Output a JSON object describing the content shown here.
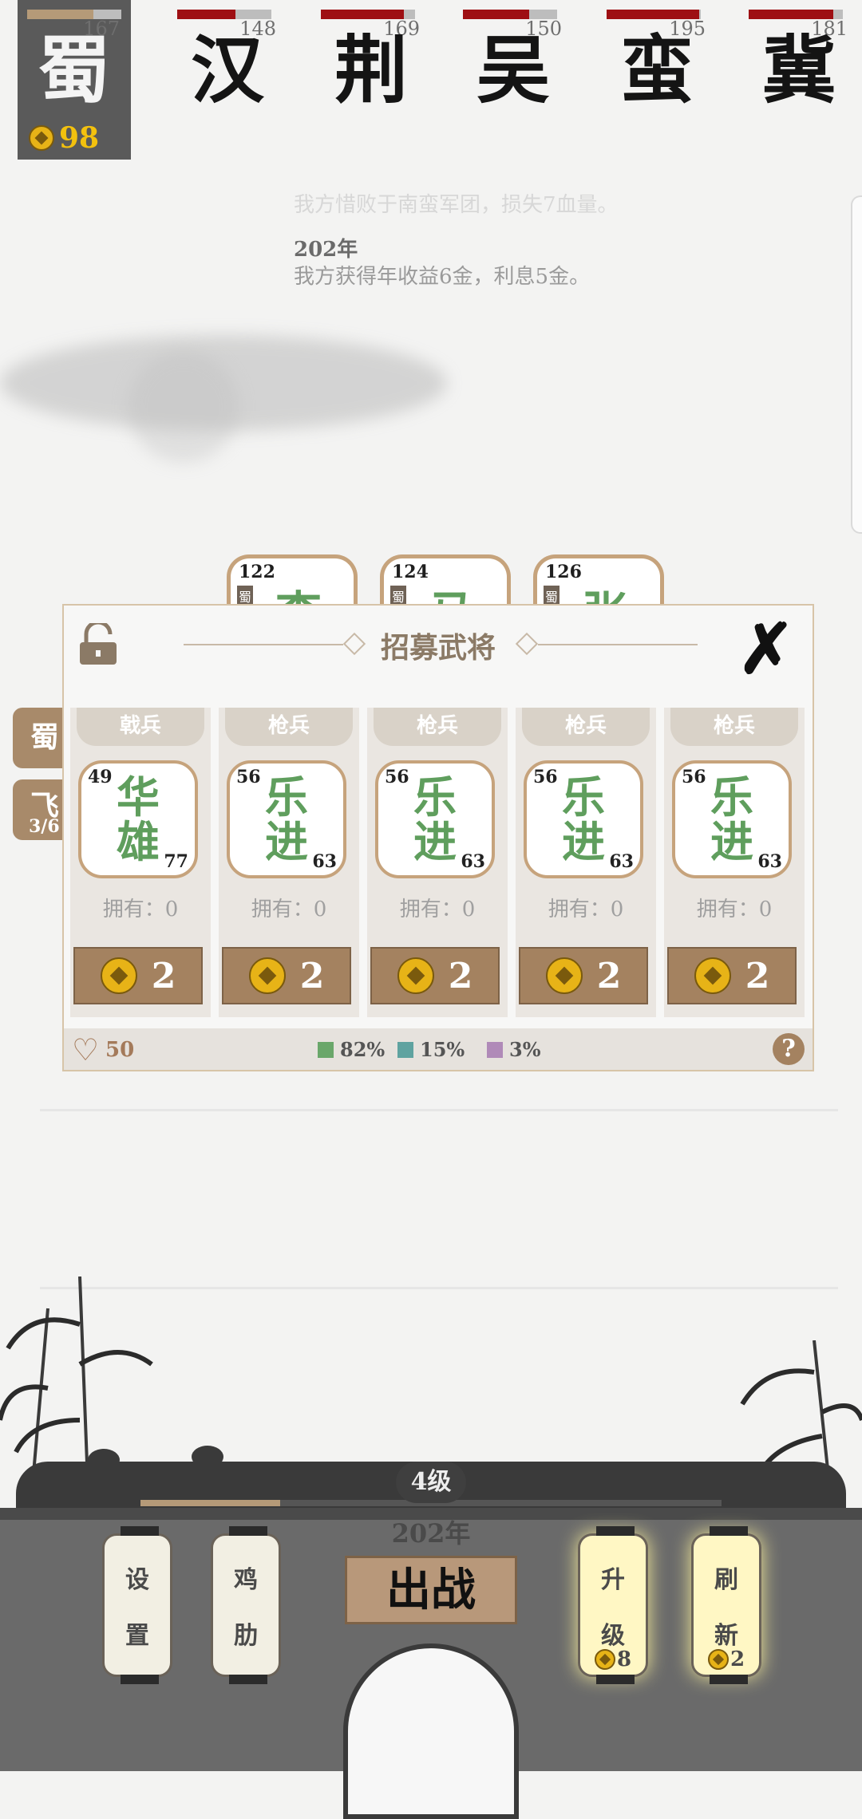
{
  "factions": [
    {
      "name": "蜀",
      "num": "167",
      "bar_fraction": 0.7,
      "gold": "98",
      "selected": true
    },
    {
      "name": "汉",
      "num": "148",
      "bar_fraction": 0.62
    },
    {
      "name": "荆",
      "num": "169",
      "bar_fraction": 0.88
    },
    {
      "name": "吴",
      "num": "150",
      "bar_fraction": 0.7
    },
    {
      "name": "蛮",
      "num": "195",
      "bar_fraction": 0.98
    },
    {
      "name": "冀",
      "num": "181",
      "bar_fraction": 0.9
    }
  ],
  "log": {
    "faded_line": "我方惜败于南蛮军团，损失7血量。",
    "year": "202年",
    "line": "我方获得年收益6金，利息5金。"
  },
  "back_cards": [
    {
      "level": "122",
      "faction": "蜀",
      "name": "李"
    },
    {
      "level": "124",
      "faction": "蜀",
      "name": "马"
    },
    {
      "level": "126",
      "faction": "蜀",
      "name": "张"
    }
  ],
  "side_tabs": {
    "faction": "蜀",
    "unit": "飞",
    "count": "3/6"
  },
  "recruit": {
    "title": "招募武将",
    "cards": [
      {
        "type": "戟兵",
        "level": "49",
        "name_top": "华",
        "name_bottom": "雄",
        "attack": "77",
        "own": "拥有：0",
        "cost": "2"
      },
      {
        "type": "枪兵",
        "level": "56",
        "name_top": "乐",
        "name_bottom": "进",
        "attack": "63",
        "own": "拥有：0",
        "cost": "2"
      },
      {
        "type": "枪兵",
        "level": "56",
        "name_top": "乐",
        "name_bottom": "进",
        "attack": "63",
        "own": "拥有：0",
        "cost": "2"
      },
      {
        "type": "枪兵",
        "level": "56",
        "name_top": "乐",
        "name_bottom": "进",
        "attack": "63",
        "own": "拥有：0",
        "cost": "2"
      },
      {
        "type": "枪兵",
        "level": "56",
        "name_top": "乐",
        "name_bottom": "进",
        "attack": "63",
        "own": "拥有：0",
        "cost": "2"
      }
    ],
    "footer": {
      "hp": "50",
      "odds": [
        {
          "pct": "82%",
          "color": "#6aa76a"
        },
        {
          "pct": "15%",
          "color": "#5fa3a0"
        },
        {
          "pct": "3%",
          "color": "#b08ab8"
        }
      ],
      "help": "?"
    }
  },
  "bottom": {
    "level": "4级",
    "xp_fraction": 0.24,
    "year": "202年",
    "lanterns": [
      {
        "top": "设",
        "bottom": "置",
        "lit": false
      },
      {
        "top": "鸡",
        "bottom": "肋",
        "lit": false
      },
      {
        "top": "升",
        "bottom": "级",
        "lit": true,
        "cost": "8"
      },
      {
        "top": "刷",
        "bottom": "新",
        "lit": true,
        "cost": "2"
      }
    ],
    "battle": "出战"
  }
}
